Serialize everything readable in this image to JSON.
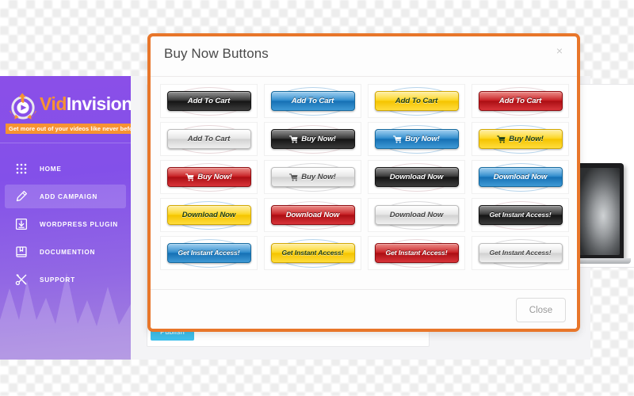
{
  "sidebar": {
    "logo": {
      "part1": "Vid",
      "part2": "Invision",
      "icon": "play-circle-logo-icon"
    },
    "tagline": "Get more out of your videos like never before",
    "items": [
      {
        "label": "HOME",
        "icon": "grid-dots-icon",
        "active": false
      },
      {
        "label": "ADD CAMPAIGN",
        "icon": "pencil-icon",
        "active": true
      },
      {
        "label": "WORDPRESS PLUGIN",
        "icon": "download-box-icon",
        "active": false
      },
      {
        "label": "DOCUMENTION",
        "icon": "book-icon",
        "active": false
      },
      {
        "label": "SUPPORT",
        "icon": "tools-cross-icon",
        "active": false
      }
    ]
  },
  "app": {
    "publish_label": "Publish"
  },
  "modal": {
    "title": "Buy Now Buttons",
    "close_x": "×",
    "close_label": "Close",
    "accent_color": "#e8762a",
    "buttons": [
      {
        "label": "Add To Cart",
        "color": "black",
        "cart": false,
        "glow": "pink"
      },
      {
        "label": "Add To Cart",
        "color": "blue",
        "cart": false,
        "glow": "blue"
      },
      {
        "label": "Add To Cart",
        "color": "yellow",
        "cart": false,
        "glow": "blue"
      },
      {
        "label": "Add To Cart",
        "color": "red",
        "cart": false,
        "glow": "pink"
      },
      {
        "label": "Add To Cart",
        "color": "grey",
        "cart": false,
        "glow": "pink"
      },
      {
        "label": "Buy Now!",
        "color": "black",
        "cart": true,
        "glow": "pink"
      },
      {
        "label": "Buy Now!",
        "color": "blue",
        "cart": true,
        "glow": "blue"
      },
      {
        "label": "Buy Now!",
        "color": "yellow",
        "cart": true,
        "glow": "blue"
      },
      {
        "label": "Buy Now!",
        "color": "red",
        "cart": true,
        "glow": "pink"
      },
      {
        "label": "Buy Now!",
        "color": "grey",
        "cart": true,
        "glow": "grey"
      },
      {
        "label": "Download Now",
        "color": "black",
        "cart": false,
        "glow": "pink"
      },
      {
        "label": "Download Now",
        "color": "blue",
        "cart": false,
        "glow": "blue"
      },
      {
        "label": "Download Now",
        "color": "yellow",
        "cart": false,
        "glow": "blue"
      },
      {
        "label": "Download Now",
        "color": "red",
        "cart": false,
        "glow": "pink"
      },
      {
        "label": "Download Now",
        "color": "grey",
        "cart": false,
        "glow": "grey"
      },
      {
        "label": "Get Instant Access!",
        "color": "black",
        "cart": false,
        "glow": "pink"
      },
      {
        "label": "Get Instant Access!",
        "color": "blue",
        "cart": false,
        "glow": "blue"
      },
      {
        "label": "Get Instant Access!",
        "color": "yellow",
        "cart": false,
        "glow": "blue"
      },
      {
        "label": "Get Instant Access!",
        "color": "red",
        "cart": false,
        "glow": "pink"
      },
      {
        "label": "Get Instant Access!",
        "color": "grey",
        "cart": false,
        "glow": "grey"
      }
    ]
  }
}
